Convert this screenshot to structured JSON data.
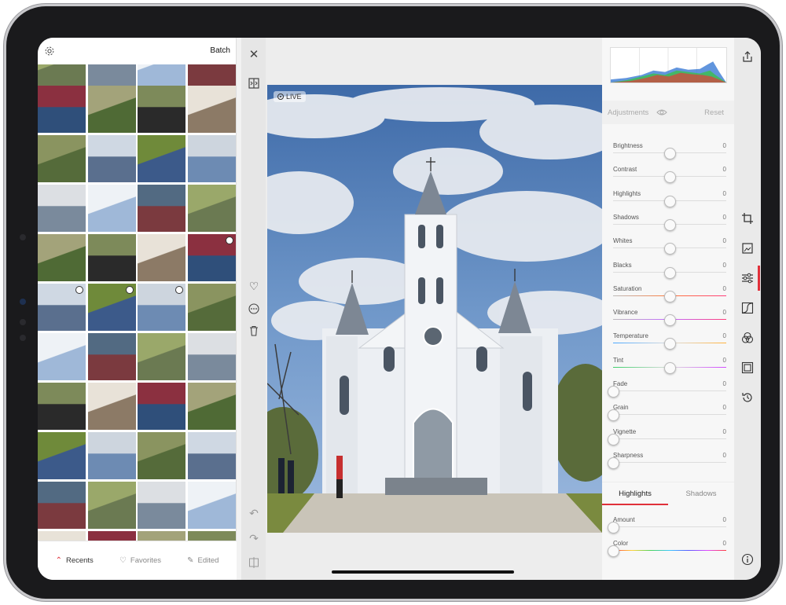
{
  "left_panel": {
    "batch_label": "Batch",
    "tabs": [
      {
        "label": "Recents",
        "icon": "chevron-up-icon",
        "active": true
      },
      {
        "label": "Favorites",
        "icon": "heart-icon",
        "active": false
      },
      {
        "label": "Edited",
        "icon": "pencil-icon",
        "active": false
      }
    ]
  },
  "canvas": {
    "live_label": "LIVE"
  },
  "adjustments": {
    "title": "Adjustments",
    "reset_label": "Reset",
    "sliders": [
      {
        "label": "Brightness",
        "value": "0",
        "level": 0.5,
        "gradient": ""
      },
      {
        "label": "Contrast",
        "value": "0",
        "level": 0.5,
        "gradient": ""
      },
      {
        "label": "Highlights",
        "value": "0",
        "level": 0.5,
        "gradient": ""
      },
      {
        "label": "Shadows",
        "value": "0",
        "level": 0.5,
        "gradient": ""
      },
      {
        "label": "Whites",
        "value": "0",
        "level": 0.5,
        "gradient": ""
      },
      {
        "label": "Blacks",
        "value": "0",
        "level": 0.5,
        "gradient": ""
      },
      {
        "label": "Saturation",
        "value": "0",
        "level": 0.5,
        "gradient": "linear-gradient(90deg,#bbb,#ff7a3a,#ff3c7a)"
      },
      {
        "label": "Vibrance",
        "value": "0",
        "level": 0.5,
        "gradient": "linear-gradient(90deg,#bbb,#c46bff,#ff3c7a)"
      },
      {
        "label": "Temperature",
        "value": "0",
        "level": 0.5,
        "gradient": "linear-gradient(90deg,#4aa8ff,#dddddd,#ffb23c)"
      },
      {
        "label": "Tint",
        "value": "0",
        "level": 0.5,
        "gradient": "linear-gradient(90deg,#3ccf6a,#dddddd,#d24bff)"
      },
      {
        "label": "Fade",
        "value": "0",
        "level": 0,
        "gradient": ""
      },
      {
        "label": "Grain",
        "value": "0",
        "level": 0,
        "gradient": ""
      },
      {
        "label": "Vignette",
        "value": "0",
        "level": 0,
        "gradient": ""
      },
      {
        "label": "Sharpness",
        "value": "0",
        "level": 0,
        "gradient": ""
      }
    ],
    "split_tabs": [
      {
        "label": "Highlights",
        "active": true
      },
      {
        "label": "Shadows",
        "active": false
      }
    ],
    "split_sliders": [
      {
        "label": "Amount",
        "value": "0",
        "level": 0,
        "gradient": ""
      },
      {
        "label": "Color",
        "value": "0",
        "level": 0,
        "gradient": "linear-gradient(90deg,#ff3c3c,#ffd23c,#4ad35a,#3cc7ff,#5a5aff,#e04bff,#ff3c3c)"
      }
    ]
  },
  "colors": {
    "accent": "#e0303a"
  }
}
